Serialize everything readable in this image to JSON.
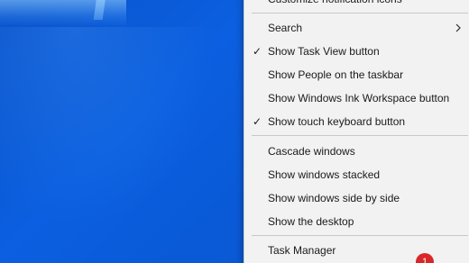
{
  "menu": {
    "top_item": "Customize notification icons",
    "search_label": "Search",
    "show_task_view": {
      "label": "Show Task View button",
      "checked": true
    },
    "show_people": {
      "label": "Show People on the taskbar",
      "checked": false
    },
    "show_ink": {
      "label": "Show Windows Ink Workspace button",
      "checked": false
    },
    "show_touch_keyboard": {
      "label": "Show touch keyboard button",
      "checked": true
    },
    "cascade": "Cascade windows",
    "stacked": "Show windows stacked",
    "side_by_side": "Show windows side by side",
    "desktop": "Show the desktop",
    "task_manager": "Task Manager",
    "check_glyph": "✓"
  },
  "badge": {
    "count": "1",
    "color": "#d8262b"
  },
  "colors": {
    "menu_bg": "#f2f2f2",
    "separator": "#c8c8c8",
    "desktop_blue": "#0b5fe0"
  },
  "icons": {
    "submenu_arrow": "chevron-right-icon",
    "checkmark": "checkmark-icon"
  }
}
